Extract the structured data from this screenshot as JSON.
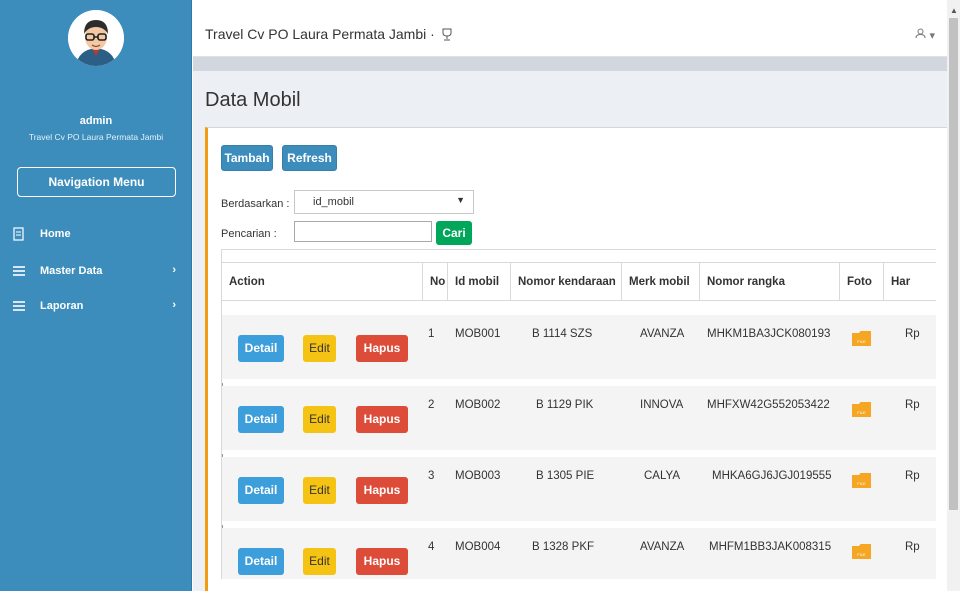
{
  "sidebar": {
    "username": "admin",
    "user_subtitle": "Travel Cv PO Laura Permata Jambi",
    "nav_menu_label": "Navigation Menu",
    "items": [
      {
        "label": "Home",
        "icon": "document-icon"
      },
      {
        "label": "Master Data",
        "icon": "menu-lines-icon"
      },
      {
        "label": "Laporan",
        "icon": "menu-lines-icon"
      }
    ]
  },
  "header": {
    "app_title": "Travel Cv PO Laura Permata Jambi ·",
    "user_menu_icon": "user-icon"
  },
  "page": {
    "title": "Data Mobil",
    "tambah_label": "Tambah",
    "refresh_label": "Refresh",
    "filter_label": "Berdasarkan :",
    "filter_value": "id_mobil",
    "search_label": "Pencarian :",
    "search_value": "",
    "cari_label": "Cari"
  },
  "table": {
    "columns": [
      "Action",
      "No",
      "Id mobil",
      "Nomor kendaraan",
      "Merk mobil",
      "Nomor rangka",
      "Foto",
      "Har"
    ],
    "action_labels": {
      "detail": "Detail",
      "edit": "Edit",
      "hapus": "Hapus"
    },
    "rows": [
      {
        "no": "1",
        "id": "MOB001",
        "nomor_kendaraan": "B 1114 SZS",
        "merk": "AVANZA",
        "rangka": "MHKM1BA3JCK080193",
        "foto": "FILE",
        "harga": "Rp"
      },
      {
        "no": "2",
        "id": "MOB002",
        "nomor_kendaraan": "B 1129 PIK",
        "merk": "INNOVA",
        "rangka": "MHFXW42G552053422",
        "foto": "FILE",
        "harga": "Rp"
      },
      {
        "no": "3",
        "id": "MOB003",
        "nomor_kendaraan": "B 1305 PIE",
        "merk": "CALYA",
        "rangka": "MHKA6GJ6JGJ019555",
        "foto": "FILE",
        "harga": "Rp"
      },
      {
        "no": "4",
        "id": "MOB004",
        "nomor_kendaraan": "B 1328 PKF",
        "merk": "AVANZA",
        "rangka": "MHFM1BB3JAK008315",
        "foto": "FILE",
        "harga": "Rp"
      }
    ]
  },
  "colors": {
    "sidebar": "#3c8dbc",
    "primary": "#3c8dbc",
    "detail": "#3c9edb",
    "edit": "#f5c313",
    "hapus": "#dd4b39",
    "cari": "#00a65a",
    "box_accent": "#f39c12"
  }
}
